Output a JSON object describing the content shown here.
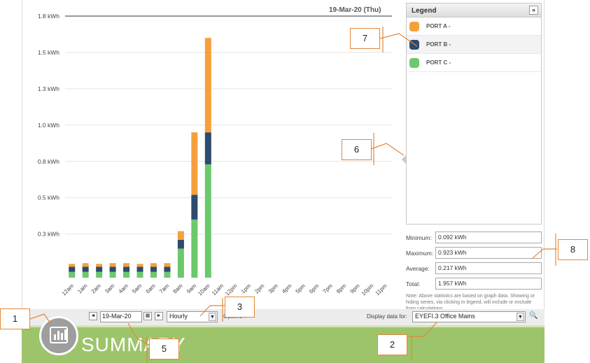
{
  "header": {
    "date": "19-Mar-20 (Thu)"
  },
  "chart_data": {
    "type": "bar",
    "stacked": true,
    "categories": [
      "12am",
      "1am",
      "2am",
      "3am",
      "4am",
      "5am",
      "6am",
      "7am",
      "8am",
      "9am",
      "10am",
      "11am",
      "12pm",
      "1pm",
      "2pm",
      "3pm",
      "4pm",
      "5pm",
      "6pm",
      "7pm",
      "8pm",
      "9pm",
      "10pm",
      "11pm"
    ],
    "series": [
      {
        "name": "PORT C -",
        "color": "#6cc86c",
        "values": [
          0.04,
          0.04,
          0.04,
          0.04,
          0.04,
          0.04,
          0.04,
          0.04,
          0.2,
          0.4,
          0.78,
          0,
          0,
          0,
          0,
          0,
          0,
          0,
          0,
          0,
          0,
          0,
          0,
          0
        ]
      },
      {
        "name": "PORT B -",
        "color": "#2e4a6e",
        "values": [
          0.035,
          0.035,
          0.035,
          0.035,
          0.035,
          0.035,
          0.035,
          0.035,
          0.06,
          0.17,
          0.22,
          0,
          0,
          0,
          0,
          0,
          0,
          0,
          0,
          0,
          0,
          0,
          0,
          0
        ]
      },
      {
        "name": "PORT A -",
        "color": "#f5a03c",
        "values": [
          0.02,
          0.025,
          0.02,
          0.025,
          0.025,
          0.02,
          0.025,
          0.025,
          0.06,
          0.43,
          0.65,
          0,
          0,
          0,
          0,
          0,
          0,
          0,
          0,
          0,
          0,
          0,
          0,
          0
        ]
      }
    ],
    "yticks": [
      "0.3 kWh",
      "0.5 kWh",
      "0.8 kWh",
      "1.0 kWh",
      "1.3 kWh",
      "1.5 kWh",
      "1.8 kWh"
    ],
    "ytick_values": [
      0.3,
      0.55,
      0.8,
      1.05,
      1.3,
      1.55,
      1.8
    ],
    "ylim": [
      0,
      1.8
    ],
    "grid": true
  },
  "legend": {
    "title": "Legend",
    "toggle": "»",
    "items": [
      {
        "label": "PORT A -",
        "color": "#f5a03c"
      },
      {
        "label": "PORT B -",
        "color": "#2e4a6e"
      },
      {
        "label": "PORT C -",
        "color": "#6cc86c"
      }
    ]
  },
  "stats": {
    "min_label": "Minimum:",
    "min_value": "0.092 kWh",
    "max_label": "Maximum:",
    "max_value": "0.923 kWh",
    "avg_label": "Average:",
    "avg_value": "0.217 kWh",
    "total_label": "Total:",
    "total_value": "1.957 kWh",
    "note": "Note: Above statistics are based on graph data. Showing or hiding series, via clicking in legend, will include or exclude from calculations."
  },
  "toolbar": {
    "prev": "◄",
    "date": "19-Mar-20",
    "next": "►",
    "interval": "Hourly",
    "options": "Options ▾",
    "display_label": "Display data for:",
    "location": "EYEFI.3 Office Mains",
    "dropdown_arrow": "▼",
    "search_icon": "🔍"
  },
  "footer": {
    "title": "Summary",
    "title_display": "SUMMARY"
  },
  "callouts": [
    "1",
    "2",
    "3",
    "5",
    "6",
    "7",
    "8"
  ]
}
